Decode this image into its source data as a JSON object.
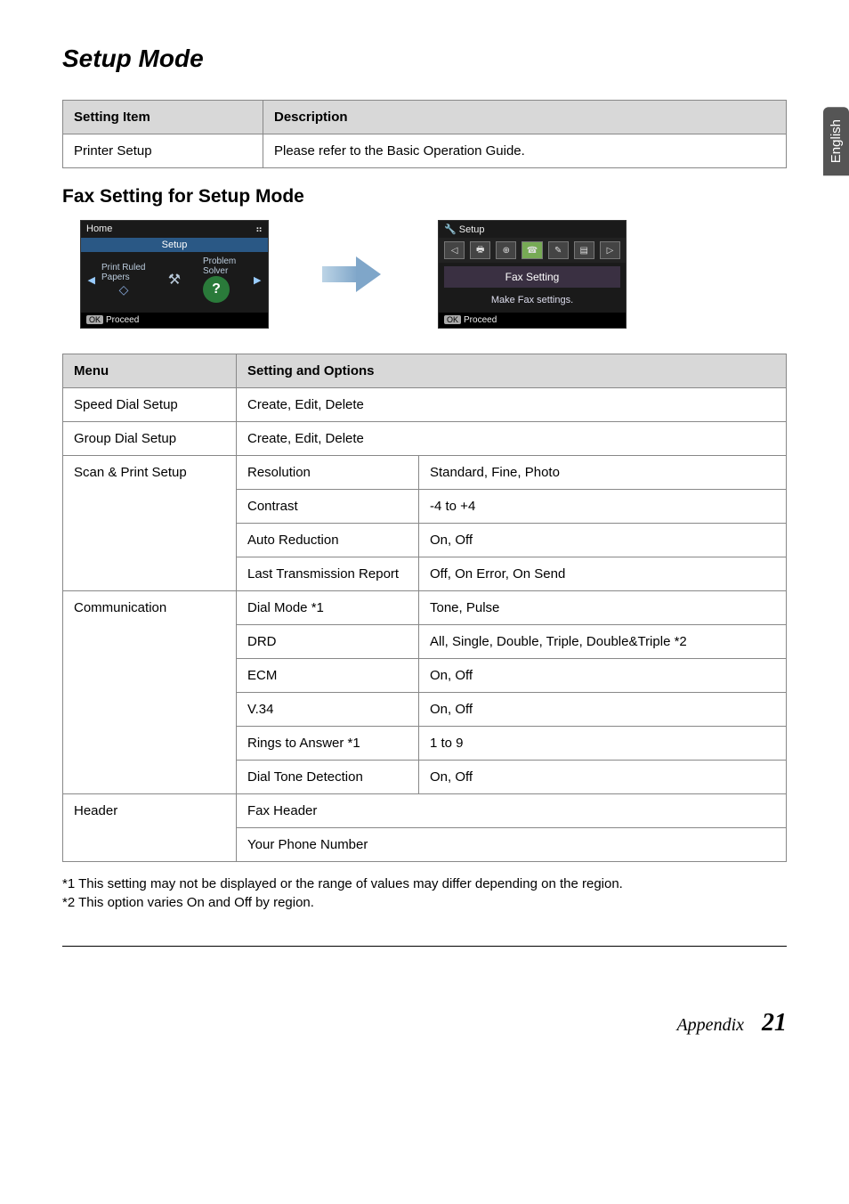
{
  "side_tab": "English",
  "title": "Setup Mode",
  "table1": {
    "headers": [
      "Setting Item",
      "Description"
    ],
    "rows": [
      [
        "Printer Setup",
        "Please refer to the Basic Operation Guide."
      ]
    ]
  },
  "subtitle": "Fax Setting for Setup Mode",
  "lcd1": {
    "top_left": "Home",
    "setup": "Setup",
    "tile_left_line1": "Print Ruled",
    "tile_left_line2": "Papers",
    "tile_right_line1": "Problem",
    "tile_right_line2": "Solver",
    "q": "?",
    "ok": "OK",
    "proceed": "Proceed"
  },
  "lcd2": {
    "title": "Setup",
    "band": "Fax Setting",
    "sub": "Make Fax settings.",
    "ok": "OK",
    "proceed": "Proceed"
  },
  "table2": {
    "headers": [
      "Menu",
      "Setting and Options"
    ],
    "rows": [
      {
        "menu": "Speed Dial Setup",
        "span": "Create, Edit, Delete"
      },
      {
        "menu": "Group Dial Setup",
        "span": "Create, Edit, Delete"
      },
      {
        "menu": "Scan & Print Setup",
        "rowspan": 4,
        "sub": [
          [
            "Resolution",
            "Standard, Fine, Photo"
          ],
          [
            "Contrast",
            "-4 to +4"
          ],
          [
            "Auto Reduction",
            "On, Off"
          ],
          [
            "Last Transmission Report",
            "Off, On Error, On Send"
          ]
        ]
      },
      {
        "menu": "Communication",
        "rowspan": 6,
        "sub": [
          [
            "Dial Mode *1",
            "Tone, Pulse"
          ],
          [
            "DRD",
            "All, Single, Double, Triple, Double&Triple *2"
          ],
          [
            "ECM",
            "On, Off"
          ],
          [
            "V.34",
            "On, Off"
          ],
          [
            "Rings to Answer *1",
            "1 to 9"
          ],
          [
            "Dial Tone Detection",
            "On, Off"
          ]
        ]
      },
      {
        "menu": "Header",
        "rowspan": 2,
        "singles": [
          "Fax Header",
          "Your Phone Number"
        ]
      }
    ]
  },
  "footnotes": [
    "*1 This setting may not be displayed or the range of values may differ depending on the region.",
    "*2 This option varies On and Off by region."
  ],
  "footer": {
    "section": "Appendix",
    "page": "21"
  }
}
